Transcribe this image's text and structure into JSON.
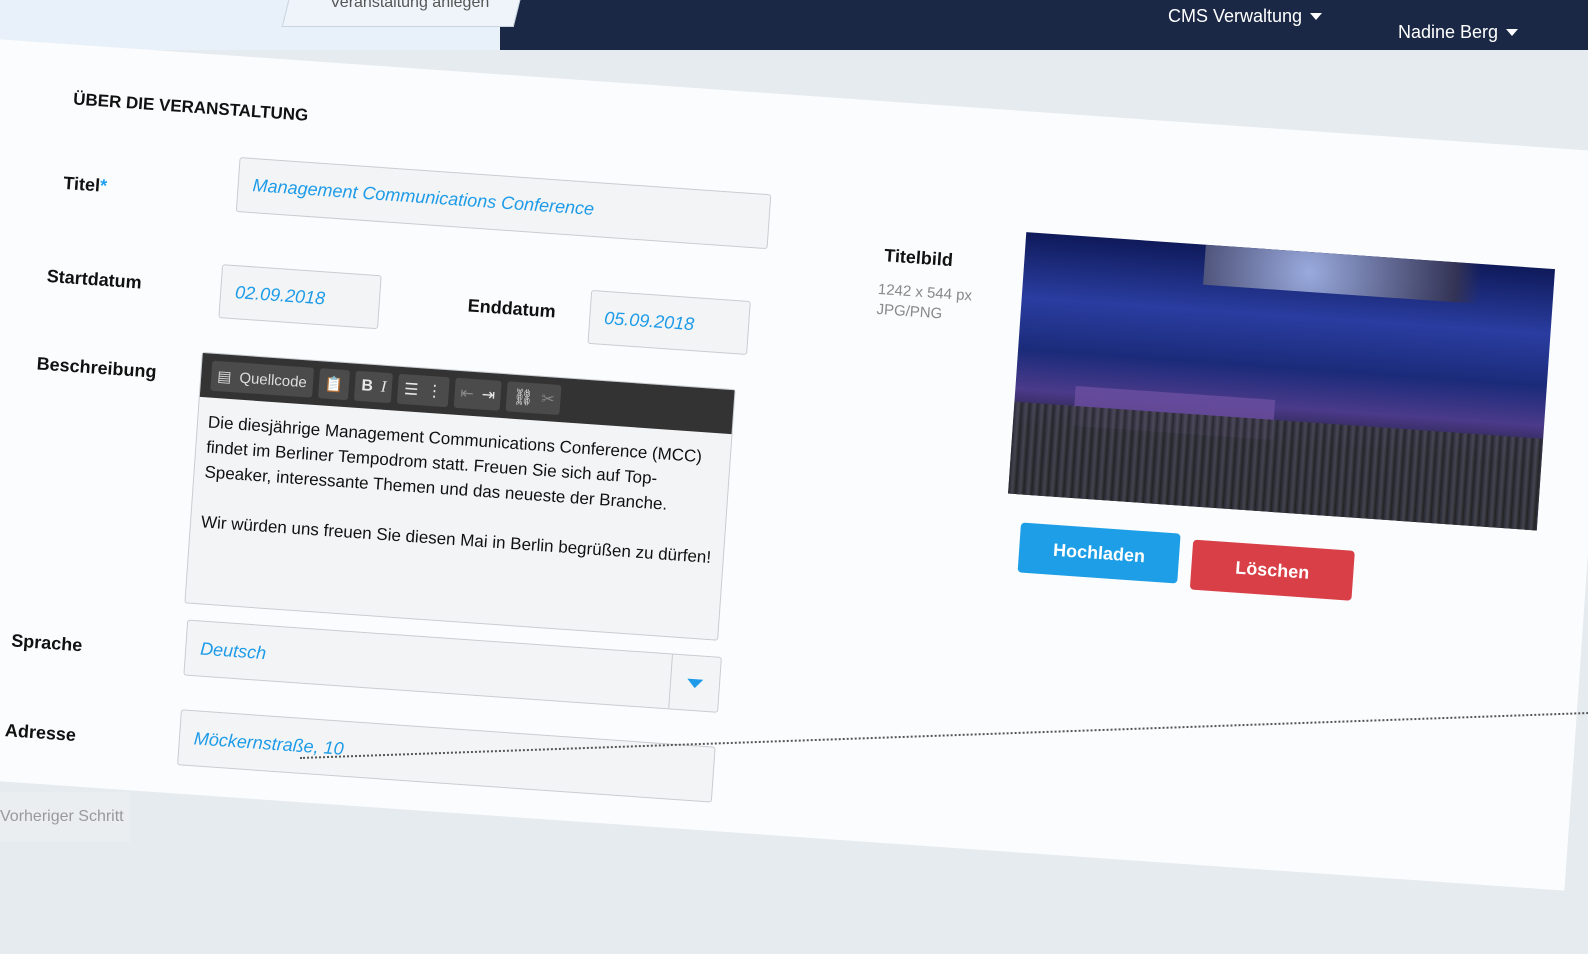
{
  "topbar": {
    "breadcrumb": "Veranstaltung anlegen",
    "cms_menu": "CMS Verwaltung",
    "user_menu": "Nadine Berg"
  },
  "section": {
    "title": "ÜBER DIE VERANSTALTUNG"
  },
  "form": {
    "title_label": "Titel",
    "title_required": "*",
    "title_value": "Management Communications Conference",
    "start_label": "Startdatum",
    "start_value": "02.09.2018",
    "end_label": "Enddatum",
    "end_value": "05.09.2018",
    "desc_label": "Beschreibung",
    "desc_text": "Die diesjährige Management Communications Conference (MCC) findet im Berliner Tempodrom statt. Freuen Sie sich auf Top-Speaker, interessante Themen und das neueste der Branche.\n\nWir würden uns freuen Sie diesen Mai in Berlin begrüßen zu dürfen!",
    "lang_label": "Sprache",
    "lang_value": "Deutsch",
    "addr_label": "Adresse",
    "addr_value": "Möckernstraße, 10"
  },
  "editor": {
    "source_label": "Quellcode",
    "bold": "B",
    "italic": "I"
  },
  "image": {
    "label": "Titelbild",
    "size_hint": "1242 x 544 px",
    "format_hint": "JPG/PNG",
    "upload_label": "Hochladen",
    "delete_label": "Löschen"
  },
  "footer": {
    "prev_label": "Vorheriger Schritt"
  },
  "colors": {
    "navy": "#1b2845",
    "accent": "#1da1f2",
    "danger": "#d83f47"
  }
}
